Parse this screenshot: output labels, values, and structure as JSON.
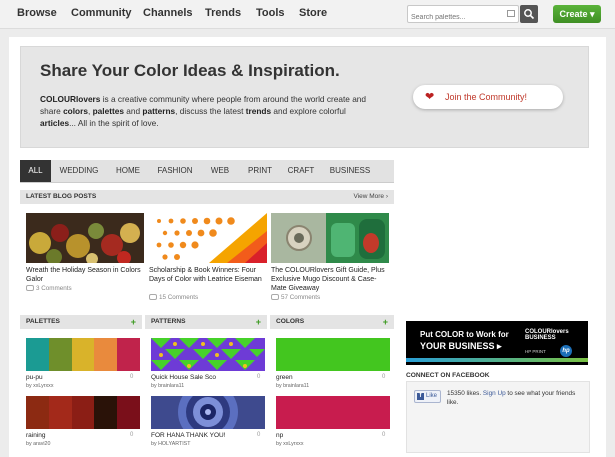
{
  "nav": {
    "items": [
      {
        "label": "Browse"
      },
      {
        "label": "Community"
      },
      {
        "label": "Channels"
      },
      {
        "label": "Trends"
      },
      {
        "label": "Tools"
      },
      {
        "label": "Store"
      }
    ],
    "search_placeholder": "Search palettes...",
    "create_label": "Create ▾"
  },
  "hero": {
    "title": "Share Your Color Ideas & Inspiration.",
    "brand": "COLOURlovers",
    "t1": " is a creative community where people from around the world create and share ",
    "colors": "colors",
    "t2": ", ",
    "palettes": "palettes",
    "t3": " and ",
    "patterns": "patterns",
    "t4": ", discuss the latest ",
    "trends": "trends",
    "t5": " and explore colorful ",
    "articles": "articles",
    "t6": "... All in the spirit of love.",
    "join_label": "Join the Community!"
  },
  "tabs": [
    {
      "label": "ALL"
    },
    {
      "label": "WEDDING"
    },
    {
      "label": "HOME"
    },
    {
      "label": "FASHION"
    },
    {
      "label": "WEB"
    },
    {
      "label": "PRINT"
    },
    {
      "label": "CRAFT"
    },
    {
      "label": "BUSINESS"
    }
  ],
  "blog": {
    "header": "LATEST BLOG POSTS",
    "view_more": "View More ›",
    "posts": [
      {
        "title": "Wreath the Holiday Season in Colors Galor",
        "comments": "3 Comments"
      },
      {
        "title": "Scholarship & Book Winners: Four Days of Color with Leatrice Eiseman",
        "comments": "15 Comments"
      },
      {
        "title": "The COLOURlovers Gift Guide, Plus Exclusive Mugo Discount & Case-Mate Giveaway",
        "comments": "57 Comments"
      }
    ]
  },
  "sections": {
    "palettes": {
      "header": "PALETTES",
      "items": [
        {
          "name": "pu-pu",
          "by": "by xxLyrxxx",
          "count": "0",
          "colors": [
            "#1b9b93",
            "#6f8f2b",
            "#d9b32a",
            "#e98a3d",
            "#c0234b"
          ]
        },
        {
          "name": "raining",
          "by": "by aravi20",
          "count": "0",
          "colors": [
            "#8c2a12",
            "#a3291a",
            "#8b1e15",
            "#2a1208",
            "#7a0f1a"
          ]
        }
      ]
    },
    "patterns": {
      "header": "PATTERNS",
      "items": [
        {
          "name": "Quick House Sale Sco",
          "by": "by brainlara11",
          "count": "0"
        },
        {
          "name": "FOR HANA THANK YOU!",
          "by": "by HOLYARTIST",
          "count": "0"
        }
      ]
    },
    "colors": {
      "header": "COLORS",
      "items": [
        {
          "name": "green",
          "by": "by brainlara11",
          "count": "0",
          "hex": "#43c61f"
        },
        {
          "name": "np",
          "by": "by xxLyrxxx",
          "count": "0",
          "hex": "#c81c4e"
        }
      ]
    },
    "add_icon": "+"
  },
  "ad": {
    "line1": "Put COLOR to Work for",
    "line2": "YOUR BUSINESS ▸",
    "brand": "COLOURlovers BUSINESS",
    "partner": "HP PRINT",
    "logo": "hp"
  },
  "facebook": {
    "header": "CONNECT ON FACEBOOK",
    "like_label": "Like",
    "like_icon": "f",
    "text_a": "15350 likes. ",
    "link": "Sign Up",
    "text_b": " to see what your friends like."
  }
}
